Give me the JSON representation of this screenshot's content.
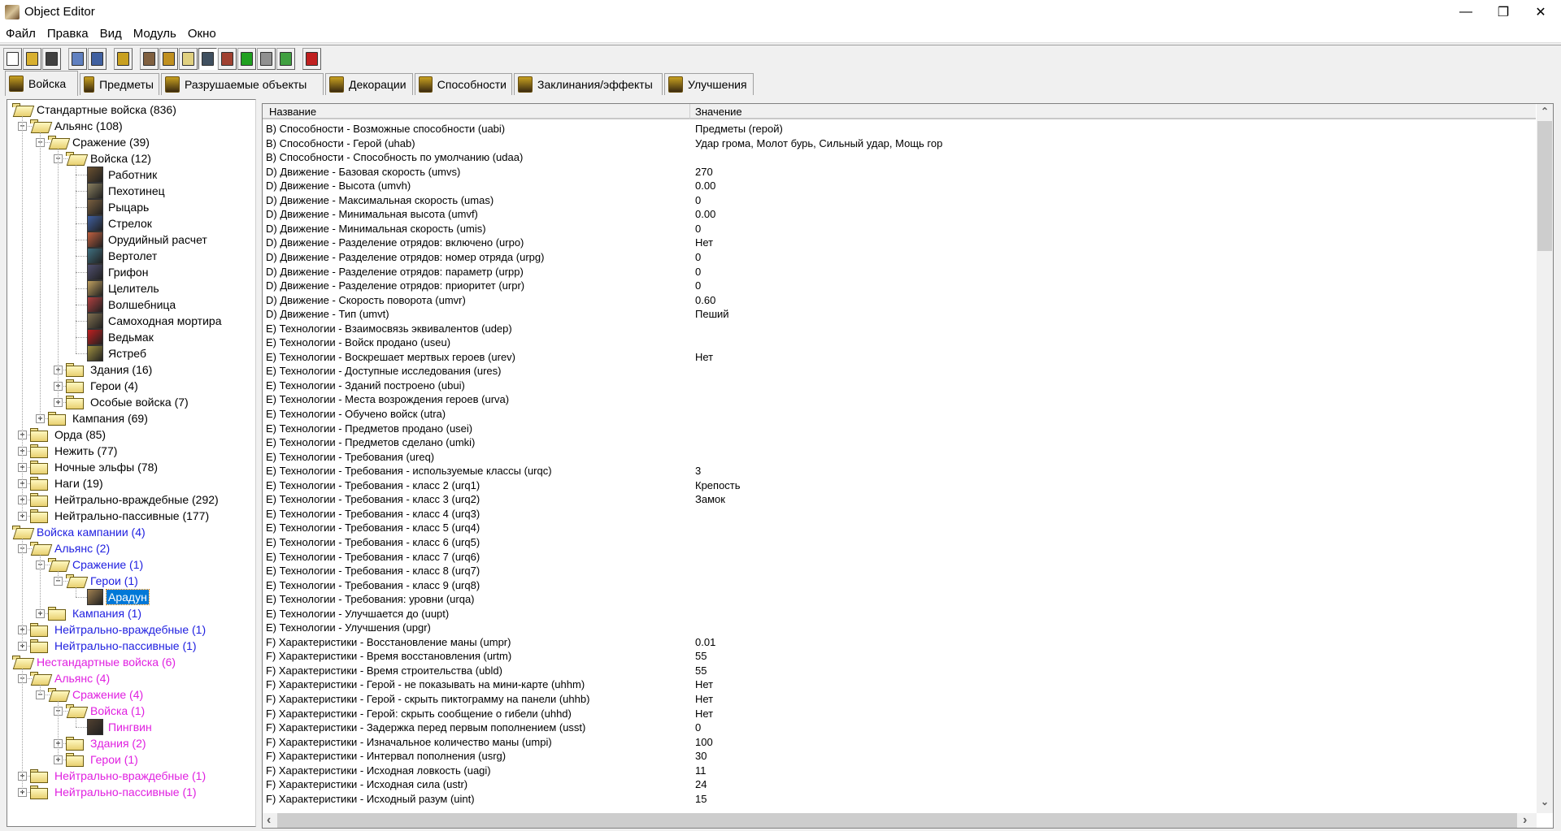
{
  "window": {
    "title": "Object Editor",
    "minimize": "—",
    "restore": "❐",
    "close": "✕"
  },
  "menu": [
    "Файл",
    "Правка",
    "Вид",
    "Модуль",
    "Окно"
  ],
  "toolbar": [
    {
      "icon": "new-file-icon",
      "color": "#ffffff"
    },
    {
      "icon": "open-folder-icon",
      "color": "#d8b030"
    },
    {
      "icon": "save-icon",
      "color": "#404040"
    },
    {
      "icon": "copy-icon",
      "color": "#6080c0"
    },
    {
      "icon": "paste-icon",
      "color": "#4060a0"
    },
    {
      "icon": "units-icon",
      "color": "#c8a020"
    },
    {
      "icon": "terrain-icon",
      "color": "#806040"
    },
    {
      "icon": "text-icon",
      "color": "#c09020"
    },
    {
      "icon": "sound-icon",
      "color": "#e0d080"
    },
    {
      "icon": "object-editor-icon",
      "color": "#405060",
      "pressed": true
    },
    {
      "icon": "campaign-icon",
      "color": "#a04030"
    },
    {
      "icon": "ai-icon",
      "color": "#20a020"
    },
    {
      "icon": "import-icon",
      "color": "#909090"
    },
    {
      "icon": "export-icon",
      "color": "#40a040"
    },
    {
      "icon": "test-map-icon",
      "color": "#c02020"
    }
  ],
  "tabs": [
    {
      "label": "Войска",
      "active": true
    },
    {
      "label": "Предметы"
    },
    {
      "label": "Разрушаемые объекты"
    },
    {
      "label": "Декорации"
    },
    {
      "label": "Способности"
    },
    {
      "label": "Заклинания/эффекты"
    },
    {
      "label": "Улучшения"
    }
  ],
  "colors": {
    "standard": "#000000",
    "campaign": "#2020e0",
    "custom": "#e020e0",
    "selection": "#0078d7"
  },
  "tree": [
    {
      "d": 0,
      "t": "open",
      "l": "Стандартные войска (836)",
      "c": "standard"
    },
    {
      "d": 1,
      "t": "open",
      "e": "-",
      "l": "Альянс (108)",
      "c": "standard"
    },
    {
      "d": 2,
      "t": "open",
      "e": "-",
      "l": "Сражение (39)",
      "c": "standard"
    },
    {
      "d": 3,
      "t": "open",
      "e": "-",
      "l": "Войска (12)",
      "c": "standard"
    },
    {
      "d": 4,
      "t": "unit",
      "l": "Работник",
      "c": "standard",
      "u": "#6a5030"
    },
    {
      "d": 4,
      "t": "unit",
      "l": "Пехотинец",
      "c": "standard",
      "u": "#8a8060"
    },
    {
      "d": 4,
      "t": "unit",
      "l": "Рыцарь",
      "c": "standard",
      "u": "#7a6040"
    },
    {
      "d": 4,
      "t": "unit",
      "l": "Стрелок",
      "c": "standard",
      "u": "#4060a0"
    },
    {
      "d": 4,
      "t": "unit",
      "l": "Орудийный расчет",
      "c": "standard",
      "u": "#c06040"
    },
    {
      "d": 4,
      "t": "unit",
      "l": "Вертолет",
      "c": "standard",
      "u": "#407080"
    },
    {
      "d": 4,
      "t": "unit",
      "l": "Грифон",
      "c": "standard",
      "u": "#505070"
    },
    {
      "d": 4,
      "t": "unit",
      "l": "Целитель",
      "c": "standard",
      "u": "#c0a060"
    },
    {
      "d": 4,
      "t": "unit",
      "l": "Волшебница",
      "c": "standard",
      "u": "#b04040"
    },
    {
      "d": 4,
      "t": "unit",
      "l": "Самоходная мортира",
      "c": "standard",
      "u": "#807050"
    },
    {
      "d": 4,
      "t": "unit",
      "l": "Ведьмак",
      "c": "standard",
      "u": "#c02020"
    },
    {
      "d": 4,
      "t": "unit",
      "l": "Ястреб",
      "c": "standard",
      "u": "#a09040"
    },
    {
      "d": 3,
      "t": "closed",
      "e": "+",
      "l": "Здания (16)",
      "c": "standard"
    },
    {
      "d": 3,
      "t": "closed",
      "e": "+",
      "l": "Герои (4)",
      "c": "standard"
    },
    {
      "d": 3,
      "t": "closed",
      "e": "+",
      "l": "Особые войска (7)",
      "c": "standard"
    },
    {
      "d": 2,
      "t": "closed",
      "e": "+",
      "l": "Кампания (69)",
      "c": "standard"
    },
    {
      "d": 1,
      "t": "closed",
      "e": "+",
      "l": "Орда (85)",
      "c": "standard"
    },
    {
      "d": 1,
      "t": "closed",
      "e": "+",
      "l": "Нежить (77)",
      "c": "standard"
    },
    {
      "d": 1,
      "t": "closed",
      "e": "+",
      "l": "Ночные эльфы (78)",
      "c": "standard"
    },
    {
      "d": 1,
      "t": "closed",
      "e": "+",
      "l": "Наги (19)",
      "c": "standard"
    },
    {
      "d": 1,
      "t": "closed",
      "e": "+",
      "l": "Нейтрально-враждебные (292)",
      "c": "standard"
    },
    {
      "d": 1,
      "t": "closed",
      "e": "+",
      "l": "Нейтрально-пассивные (177)",
      "c": "standard"
    },
    {
      "d": 0,
      "t": "open",
      "l": "Войска кампании (4)",
      "c": "campaign"
    },
    {
      "d": 1,
      "t": "open",
      "e": "-",
      "l": "Альянс (2)",
      "c": "campaign"
    },
    {
      "d": 2,
      "t": "open",
      "e": "-",
      "l": "Сражение (1)",
      "c": "campaign"
    },
    {
      "d": 3,
      "t": "open",
      "e": "-",
      "l": "Герои (1)",
      "c": "campaign"
    },
    {
      "d": 4,
      "t": "unit",
      "l": "Арадун",
      "c": "campaign",
      "u": "#a08050",
      "sel": true
    },
    {
      "d": 2,
      "t": "closed",
      "e": "+",
      "l": "Кампания (1)",
      "c": "campaign"
    },
    {
      "d": 1,
      "t": "closed",
      "e": "+",
      "l": "Нейтрально-враждебные (1)",
      "c": "campaign"
    },
    {
      "d": 1,
      "t": "closed",
      "e": "+",
      "l": "Нейтрально-пассивные (1)",
      "c": "campaign"
    },
    {
      "d": 0,
      "t": "open",
      "l": "Нестандартные войска (6)",
      "c": "custom"
    },
    {
      "d": 1,
      "t": "open",
      "e": "-",
      "l": "Альянс (4)",
      "c": "custom"
    },
    {
      "d": 2,
      "t": "open",
      "e": "-",
      "l": "Сражение (4)",
      "c": "custom"
    },
    {
      "d": 3,
      "t": "open",
      "e": "-",
      "l": "Войска (1)",
      "c": "custom"
    },
    {
      "d": 4,
      "t": "unit",
      "l": "Пингвин",
      "c": "custom",
      "u": "#504030"
    },
    {
      "d": 3,
      "t": "closed",
      "e": "+",
      "l": "Здания (2)",
      "c": "custom"
    },
    {
      "d": 3,
      "t": "closed",
      "e": "+",
      "l": "Герои (1)",
      "c": "custom"
    },
    {
      "d": 1,
      "t": "closed",
      "e": "+",
      "l": "Нейтрально-враждебные (1)",
      "c": "custom"
    },
    {
      "d": 1,
      "t": "closed",
      "e": "+",
      "l": "Нейтрально-пассивные (1)",
      "c": "custom"
    }
  ],
  "grid": {
    "headers": [
      "Название",
      "Значение"
    ],
    "rows": [
      [
        "B) Способности - Возможные способности (uabi)",
        "Предметы (герой)"
      ],
      [
        "B) Способности - Герой (uhab)",
        "Удар грома, Молот бурь, Сильный удар, Мощь гор"
      ],
      [
        "B) Способности - Способность по умолчанию (udaa)",
        ""
      ],
      [
        "D) Движение - Базовая скорость (umvs)",
        "270"
      ],
      [
        "D) Движение - Высота (umvh)",
        "0.00"
      ],
      [
        "D) Движение - Максимальная скорость (umas)",
        "0"
      ],
      [
        "D) Движение - Минимальная высота (umvf)",
        "0.00"
      ],
      [
        "D) Движение - Минимальная скорость (umis)",
        "0"
      ],
      [
        "D) Движение - Разделение отрядов: включено (urpo)",
        "Нет"
      ],
      [
        "D) Движение - Разделение отрядов: номер отряда (urpg)",
        "0"
      ],
      [
        "D) Движение - Разделение отрядов: параметр (urpp)",
        "0"
      ],
      [
        "D) Движение - Разделение отрядов: приоритет (urpr)",
        "0"
      ],
      [
        "D) Движение - Скорость поворота (umvr)",
        "0.60"
      ],
      [
        "D) Движение - Тип (umvt)",
        "Пеший"
      ],
      [
        "E) Технологии - Взаимосвязь эквивалентов (udep)",
        ""
      ],
      [
        "E) Технологии - Войск продано (useu)",
        ""
      ],
      [
        "E) Технологии - Воскрешает мертвых героев (urev)",
        "Нет"
      ],
      [
        "E) Технологии - Доступные исследования (ures)",
        ""
      ],
      [
        "E) Технологии - Зданий построено (ubui)",
        ""
      ],
      [
        "E) Технологии - Места возрождения героев (urva)",
        ""
      ],
      [
        "E) Технологии - Обучено войск (utra)",
        ""
      ],
      [
        "E) Технологии - Предметов продано (usei)",
        ""
      ],
      [
        "E) Технологии - Предметов сделано (umki)",
        ""
      ],
      [
        "E) Технологии - Требования (ureq)",
        ""
      ],
      [
        "E) Технологии - Требования - используемые классы (urqc)",
        "3"
      ],
      [
        "E) Технологии - Требования - класс 2 (urq1)",
        "Крепость"
      ],
      [
        "E) Технологии - Требования - класс 3 (urq2)",
        "Замок"
      ],
      [
        "E) Технологии - Требования - класс 4 (urq3)",
        ""
      ],
      [
        "E) Технологии - Требования - класс 5 (urq4)",
        ""
      ],
      [
        "E) Технологии - Требования - класс 6 (urq5)",
        ""
      ],
      [
        "E) Технологии - Требования - класс 7 (urq6)",
        ""
      ],
      [
        "E) Технологии - Требования - класс 8 (urq7)",
        ""
      ],
      [
        "E) Технологии - Требования - класс 9 (urq8)",
        ""
      ],
      [
        "E) Технологии - Требования: уровни (urqa)",
        ""
      ],
      [
        "E) Технологии - Улучшается до (uupt)",
        ""
      ],
      [
        "E) Технологии - Улучшения (upgr)",
        ""
      ],
      [
        "F) Характеристики - Восстановление маны (umpr)",
        "0.01"
      ],
      [
        "F) Характеристики - Время восстановления (urtm)",
        "55"
      ],
      [
        "F) Характеристики - Время строительства (ubld)",
        "55"
      ],
      [
        "F) Характеристики - Герой - не показывать на мини-карте (uhhm)",
        "Нет"
      ],
      [
        "F) Характеристики - Герой - скрыть пиктограмму на панели (uhhb)",
        "Нет"
      ],
      [
        "F) Характеристики - Герой: скрыть сообщение о гибели (uhhd)",
        "Нет"
      ],
      [
        "F) Характеристики - Задержка перед первым пополнением (usst)",
        "0"
      ],
      [
        "F) Характеристики - Изначальное количество маны (umpi)",
        "100"
      ],
      [
        "F) Характеристики - Интервал пополнения (usrg)",
        "30"
      ],
      [
        "F) Характеристики - Исходная ловкость (uagi)",
        "11"
      ],
      [
        "F) Характеристики - Исходная сила (ustr)",
        "24"
      ],
      [
        "F) Характеристики - Исходный разум (uint)",
        "15"
      ]
    ]
  },
  "scroll": {
    "up": "⌃",
    "down": "⌄",
    "left": "‹",
    "right": "›"
  }
}
